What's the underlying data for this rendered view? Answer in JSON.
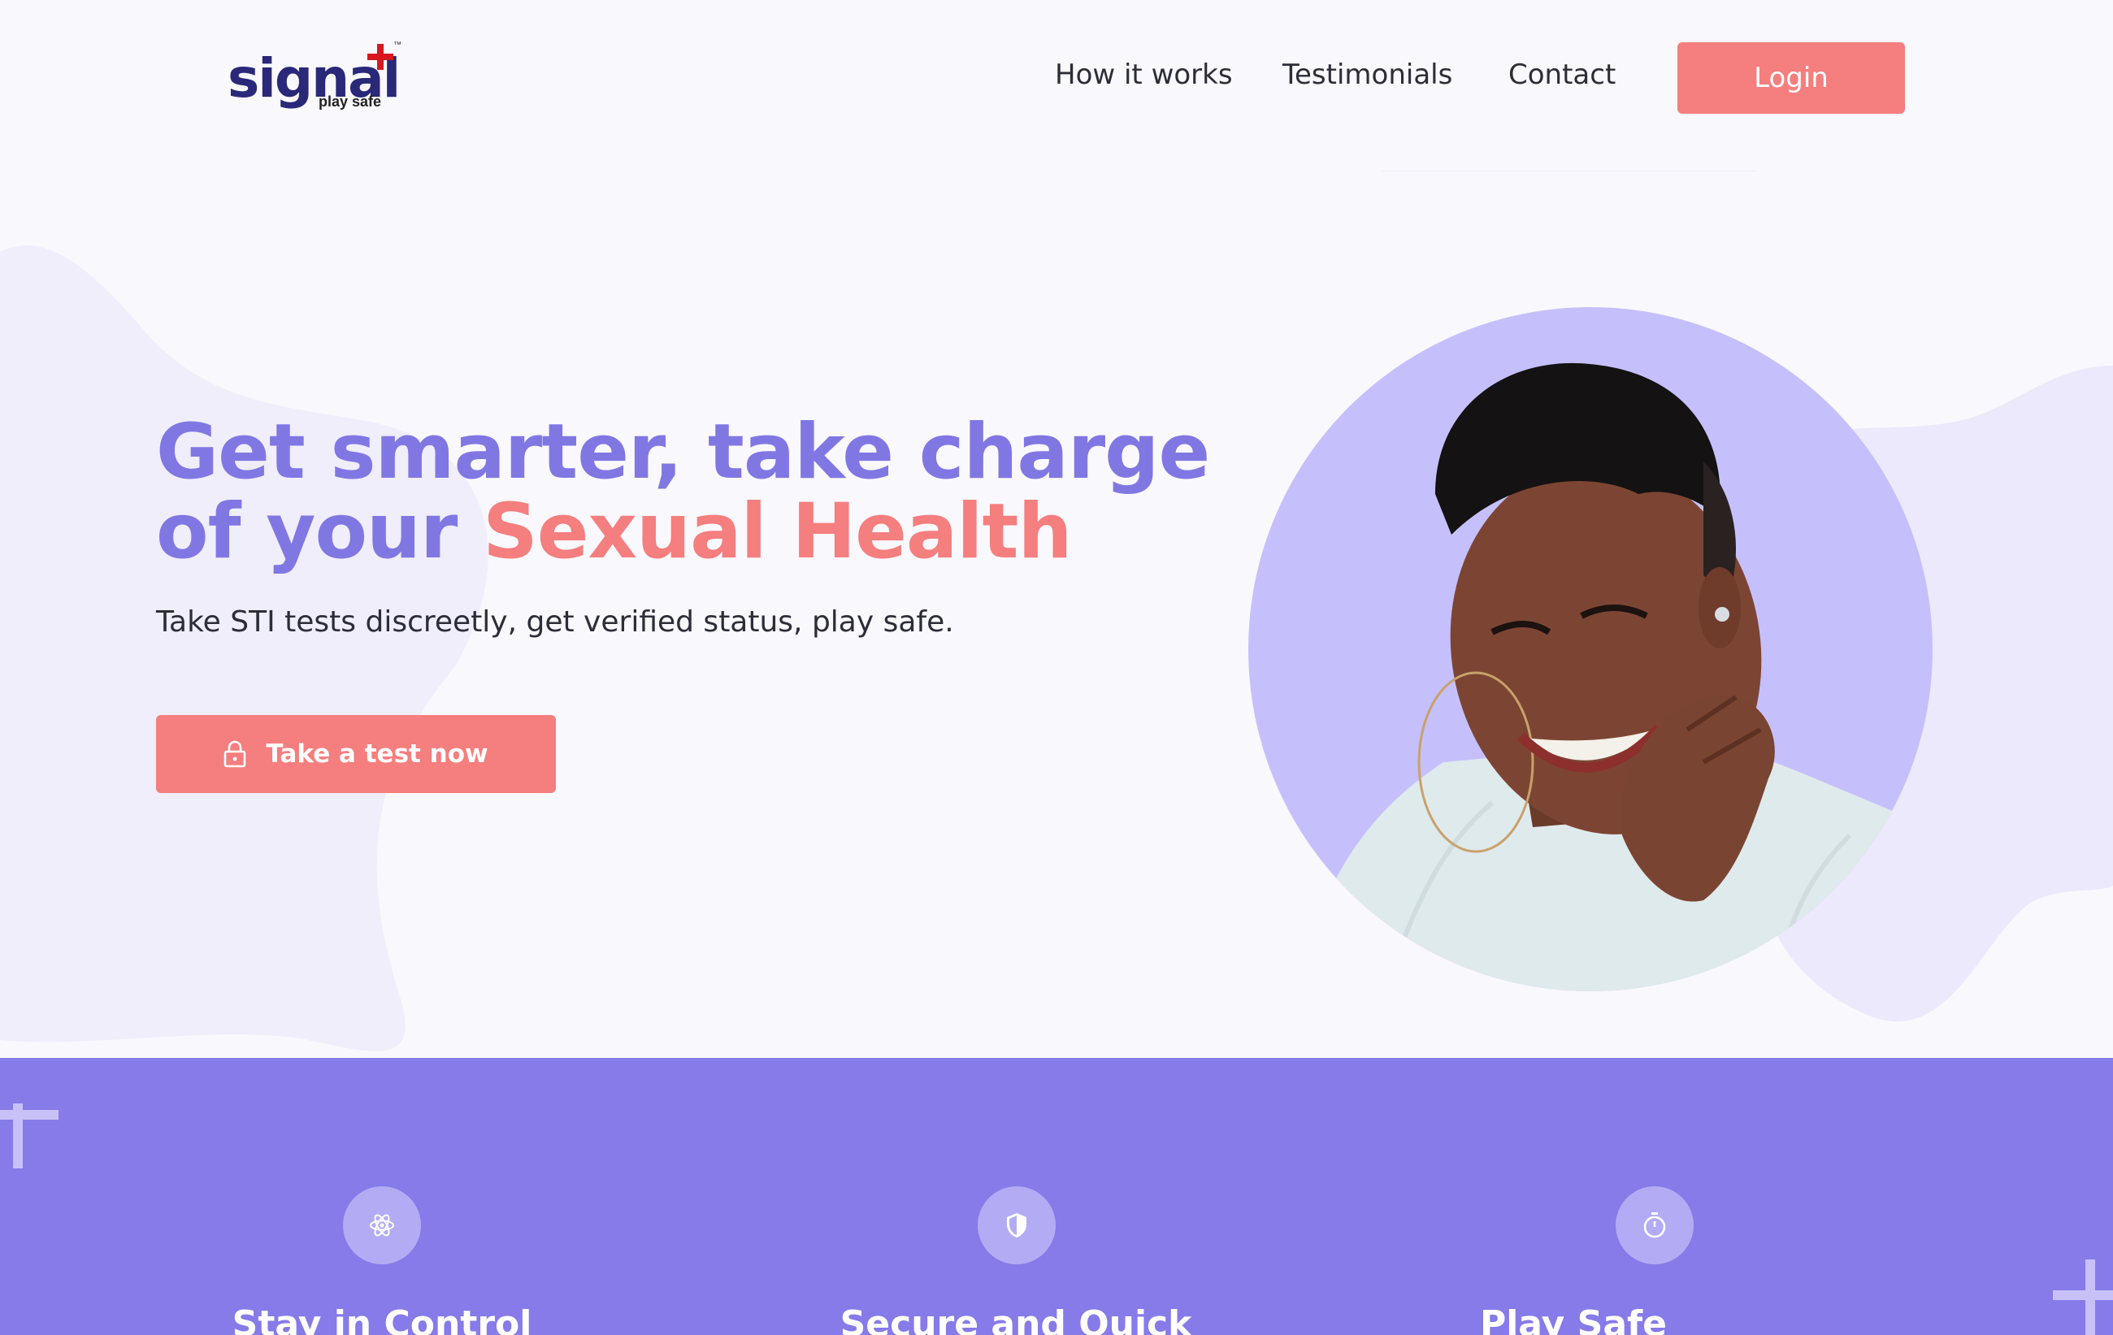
{
  "brand": {
    "logo_text": "signal",
    "tagline": "play safe",
    "trademark": "™"
  },
  "nav": {
    "items": [
      {
        "label": "How it works"
      },
      {
        "label": "Testimonials"
      },
      {
        "label": "Contact"
      }
    ],
    "login_label": "Login"
  },
  "hero": {
    "title_line1": "Get smarter, take charge",
    "title_line2_prefix": "of your ",
    "title_line2_accent": "Sexual Health",
    "subtitle": "Take STI tests discreetly, get verified status, play safe.",
    "cta_label": "Take a test now",
    "cta_icon": "lock-icon"
  },
  "features": [
    {
      "title": "Stay in Control",
      "icon": "atom-icon"
    },
    {
      "title": "Secure and Quick",
      "icon": "shield-icon"
    },
    {
      "title": "Play Safe",
      "icon": "stopwatch-icon"
    }
  ],
  "colors": {
    "primary_purple": "#8177e3",
    "accent_coral": "#f57e7e",
    "band_purple": "#867be8",
    "portrait_bg": "#c5c0fb",
    "logo_navy": "#2a2878",
    "logo_red": "#d7181f"
  }
}
